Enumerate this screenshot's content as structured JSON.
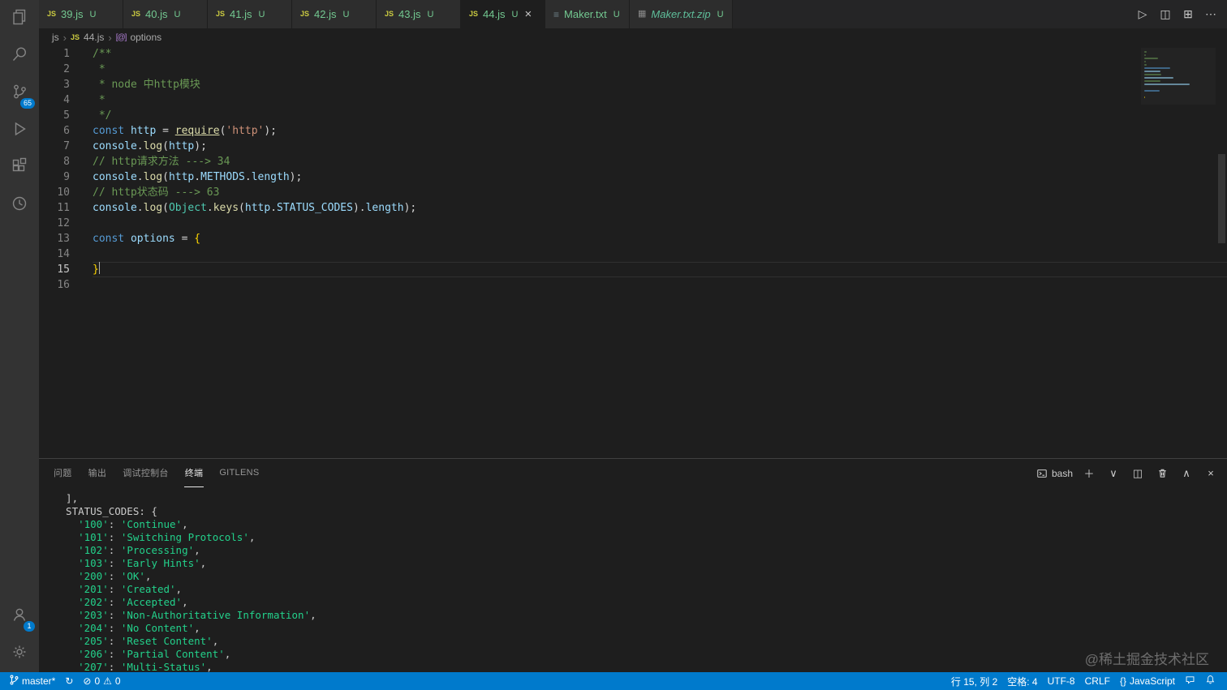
{
  "colors": {
    "accent": "#007acc",
    "editor_bg": "#1e1e1e",
    "activity_bg": "#333333",
    "untracked_green": "#73c991",
    "terminal_green": "#23d18b"
  },
  "activity_bar": {
    "items": [
      {
        "name": "explorer"
      },
      {
        "name": "search"
      },
      {
        "name": "source-control",
        "badge": "65"
      },
      {
        "name": "run-debug"
      },
      {
        "name": "extensions"
      },
      {
        "name": "timeline"
      }
    ],
    "bottom_items": [
      {
        "name": "accounts",
        "badge": "1"
      },
      {
        "name": "settings"
      }
    ]
  },
  "editor_tabs": {
    "tabs": [
      {
        "label": "39.js",
        "icon": "js",
        "badge": "U"
      },
      {
        "label": "40.js",
        "icon": "js",
        "badge": "U"
      },
      {
        "label": "41.js",
        "icon": "js",
        "badge": "U"
      },
      {
        "label": "42.js",
        "icon": "js",
        "badge": "U"
      },
      {
        "label": "43.js",
        "icon": "js",
        "badge": "U"
      },
      {
        "label": "44.js",
        "icon": "js",
        "badge": "U",
        "active": true,
        "closable": true
      },
      {
        "label": "Maker.txt",
        "icon": "txt",
        "badge": "U"
      },
      {
        "label": "Maker.txt.zip",
        "icon": "zip",
        "badge": "U",
        "italic": true
      }
    ]
  },
  "breadcrumb": {
    "folder": "js",
    "file": "44.js",
    "symbol": "options"
  },
  "editor": {
    "lines": [
      {
        "n": 1,
        "s": [
          [
            "/**",
            "cm"
          ]
        ]
      },
      {
        "n": 2,
        "s": [
          [
            " *",
            "cm"
          ]
        ]
      },
      {
        "n": 3,
        "s": [
          [
            " * node 中http模块",
            "cm"
          ]
        ]
      },
      {
        "n": 4,
        "s": [
          [
            " *",
            "cm"
          ]
        ]
      },
      {
        "n": 5,
        "s": [
          [
            " */",
            "cm"
          ]
        ]
      },
      {
        "n": 6,
        "s": [
          [
            "const",
            "kw"
          ],
          [
            " ",
            "pl"
          ],
          [
            "http",
            "vr"
          ],
          [
            " = ",
            "pl"
          ],
          [
            "require",
            "fn u"
          ],
          [
            "(",
            "pl"
          ],
          [
            "'http'",
            "st"
          ],
          [
            ");",
            "pl"
          ]
        ]
      },
      {
        "n": 7,
        "s": [
          [
            "console",
            "vr"
          ],
          [
            ".",
            "pl"
          ],
          [
            "log",
            "fn"
          ],
          [
            "(",
            "pl"
          ],
          [
            "http",
            "vr"
          ],
          [
            ");",
            "pl"
          ]
        ]
      },
      {
        "n": 8,
        "s": [
          [
            "// http请求方法 ---> 34",
            "cm"
          ]
        ]
      },
      {
        "n": 9,
        "s": [
          [
            "console",
            "vr"
          ],
          [
            ".",
            "pl"
          ],
          [
            "log",
            "fn"
          ],
          [
            "(",
            "pl"
          ],
          [
            "http",
            "vr"
          ],
          [
            ".",
            "pl"
          ],
          [
            "METHODS",
            "vr"
          ],
          [
            ".",
            "pl"
          ],
          [
            "length",
            "vr"
          ],
          [
            ");",
            "pl"
          ]
        ]
      },
      {
        "n": 10,
        "s": [
          [
            "// http状态码 ---> 63",
            "cm"
          ]
        ]
      },
      {
        "n": 11,
        "s": [
          [
            "console",
            "vr"
          ],
          [
            ".",
            "pl"
          ],
          [
            "log",
            "fn"
          ],
          [
            "(",
            "pl"
          ],
          [
            "Object",
            "cl"
          ],
          [
            ".",
            "pl"
          ],
          [
            "keys",
            "fn"
          ],
          [
            "(",
            "pl"
          ],
          [
            "http",
            "vr"
          ],
          [
            ".",
            "pl"
          ],
          [
            "STATUS_CODES",
            "vr"
          ],
          [
            ")",
            "pl"
          ],
          [
            ".",
            "pl"
          ],
          [
            "length",
            "vr"
          ],
          [
            ");",
            "pl"
          ]
        ]
      },
      {
        "n": 12,
        "s": []
      },
      {
        "n": 13,
        "s": [
          [
            "const",
            "kw"
          ],
          [
            " ",
            "pl"
          ],
          [
            "options",
            "vr"
          ],
          [
            " = ",
            "pl"
          ],
          [
            "{",
            "br"
          ]
        ]
      },
      {
        "n": 14,
        "s": []
      },
      {
        "n": 15,
        "s": [
          [
            "}",
            "br"
          ]
        ],
        "cursor": true,
        "current": true
      },
      {
        "n": 16,
        "s": []
      }
    ]
  },
  "panel": {
    "tabs": [
      {
        "label": "问题"
      },
      {
        "label": "输出"
      },
      {
        "label": "调试控制台"
      },
      {
        "label": "终端",
        "active": true
      },
      {
        "label": "GITLENS"
      }
    ],
    "terminal_label": "bash",
    "terminal": {
      "head_lines": [
        "  ],",
        "  STATUS_CODES: {"
      ],
      "entries": [
        {
          "key": "100",
          "value": "Continue"
        },
        {
          "key": "101",
          "value": "Switching Protocols"
        },
        {
          "key": "102",
          "value": "Processing"
        },
        {
          "key": "103",
          "value": "Early Hints"
        },
        {
          "key": "200",
          "value": "OK"
        },
        {
          "key": "201",
          "value": "Created"
        },
        {
          "key": "202",
          "value": "Accepted"
        },
        {
          "key": "203",
          "value": "Non-Authoritative Information"
        },
        {
          "key": "204",
          "value": "No Content"
        },
        {
          "key": "205",
          "value": "Reset Content"
        },
        {
          "key": "206",
          "value": "Partial Content"
        },
        {
          "key": "207",
          "value": "Multi-Status"
        }
      ]
    }
  },
  "status_bar": {
    "branch": "master*",
    "errors": "0",
    "warnings": "0",
    "line_col": "行 15, 列 2",
    "indent": "空格: 4",
    "encoding": "UTF-8",
    "eol": "CRLF",
    "language_icon": "{}",
    "language": "JavaScript"
  },
  "watermark": "@稀土掘金技术社区"
}
